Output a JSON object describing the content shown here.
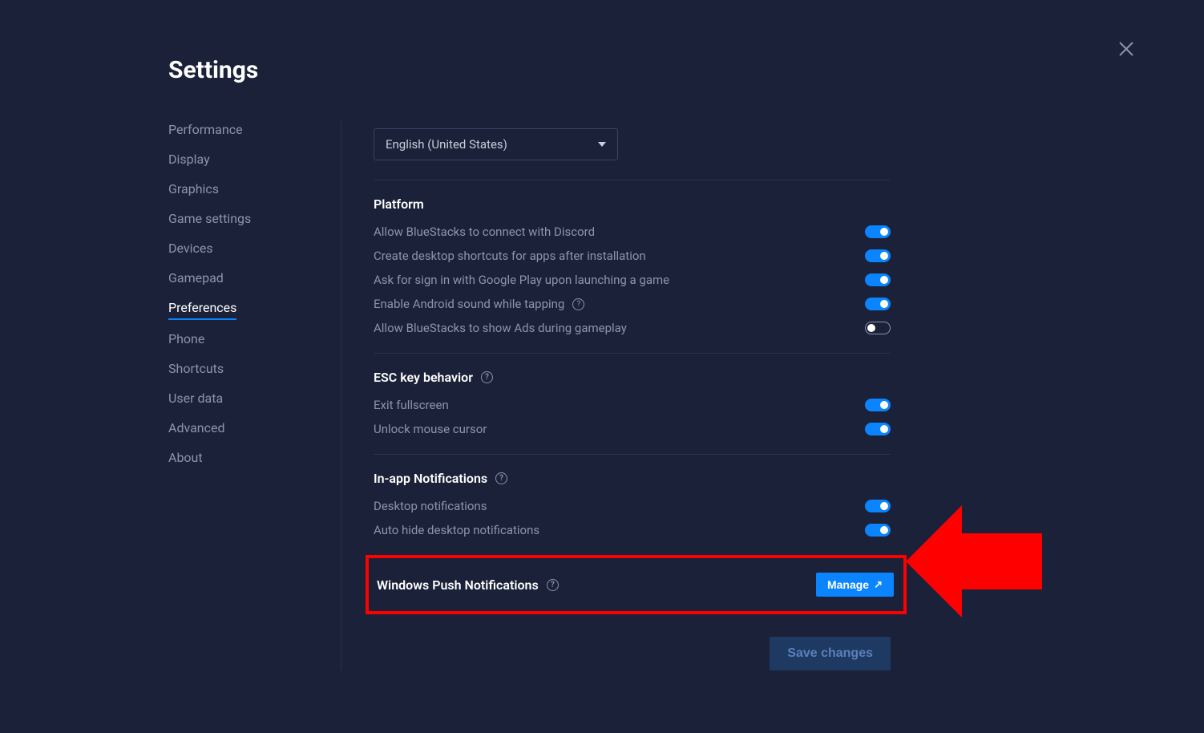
{
  "page_title": "Settings",
  "sidebar": {
    "items": [
      {
        "label": "Performance",
        "active": false
      },
      {
        "label": "Display",
        "active": false
      },
      {
        "label": "Graphics",
        "active": false
      },
      {
        "label": "Game settings",
        "active": false
      },
      {
        "label": "Devices",
        "active": false
      },
      {
        "label": "Gamepad",
        "active": false
      },
      {
        "label": "Preferences",
        "active": true
      },
      {
        "label": "Phone",
        "active": false
      },
      {
        "label": "Shortcuts",
        "active": false
      },
      {
        "label": "User data",
        "active": false
      },
      {
        "label": "Advanced",
        "active": false
      },
      {
        "label": "About",
        "active": false
      }
    ]
  },
  "language_dropdown": {
    "selected": "English (United States)"
  },
  "sections": {
    "platform": {
      "title": "Platform",
      "settings": [
        {
          "label": "Allow BlueStacks to connect with Discord",
          "on": true,
          "help": false
        },
        {
          "label": "Create desktop shortcuts for apps after installation",
          "on": true,
          "help": false
        },
        {
          "label": "Ask for sign in with Google Play upon launching a game",
          "on": true,
          "help": false
        },
        {
          "label": "Enable Android sound while tapping",
          "on": true,
          "help": true
        },
        {
          "label": "Allow BlueStacks to show Ads during gameplay",
          "on": false,
          "help": false
        }
      ]
    },
    "esc": {
      "title": "ESC key behavior",
      "help": true,
      "settings": [
        {
          "label": "Exit fullscreen",
          "on": true
        },
        {
          "label": "Unlock mouse cursor",
          "on": true
        }
      ]
    },
    "inapp": {
      "title": "In-app Notifications",
      "help": true,
      "settings": [
        {
          "label": "Desktop notifications",
          "on": true
        },
        {
          "label": "Auto hide desktop notifications",
          "on": true
        }
      ]
    },
    "push": {
      "title": "Windows Push Notifications",
      "help": true,
      "button_label": "Manage"
    }
  },
  "save_button": "Save changes"
}
